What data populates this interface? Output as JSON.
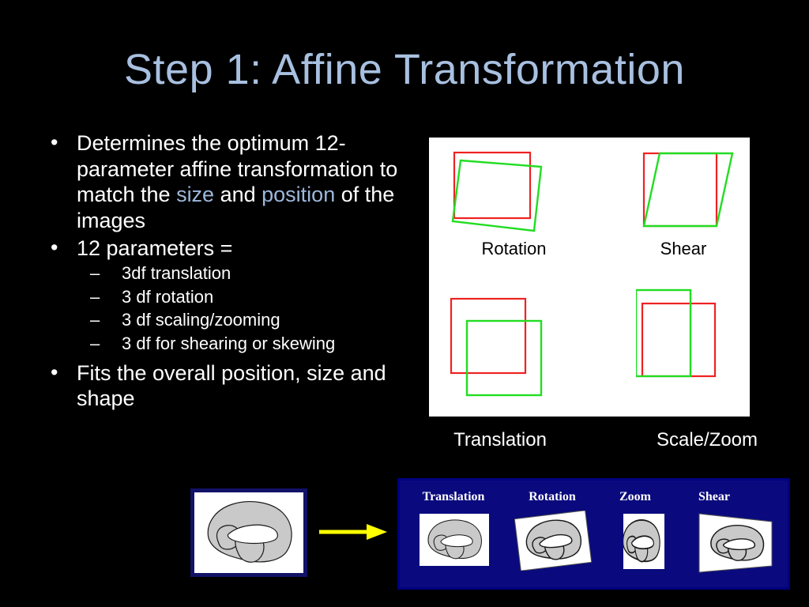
{
  "slide": {
    "title": "Step 1: Affine Transformation",
    "title_color": "#A8C0E0",
    "background_color": "#000000",
    "body_text_color": "#FFFFFF",
    "highlight_color": "#9DB8DC"
  },
  "bullets": {
    "bullet_marker": "•",
    "sub_marker": "–",
    "items": [
      {
        "segments": [
          {
            "text": "Determines the optimum 12-parameter affine transformation to match the ",
            "style": "normal"
          },
          {
            "text": "size",
            "style": "highlight"
          },
          {
            "text": " and ",
            "style": "normal"
          },
          {
            "text": "position",
            "style": "highlight"
          },
          {
            "text": " of the images",
            "style": "normal"
          }
        ]
      },
      {
        "text": "12 parameters =",
        "sub_items": [
          "3df translation",
          "3 df rotation",
          "3 df scaling/zooming",
          "3 df for shearing or skewing"
        ]
      },
      {
        "text": "Fits the overall position, size and  shape"
      }
    ]
  },
  "diagram_panel": {
    "background_color": "#FFFFFF",
    "reference_shape_color": "#ee2222",
    "transformed_shape_color": "#22dd22",
    "inside_captions": [
      {
        "label": "Rotation",
        "color": "#000000"
      },
      {
        "label": "Shear",
        "color": "#000000"
      }
    ],
    "outside_captions": [
      {
        "label": "Translation",
        "color": "#FFFFFF"
      },
      {
        "label": "Scale/Zoom",
        "color": "#FFFFFF"
      }
    ]
  },
  "brain_strip": {
    "background_color": "#0A0A7E",
    "label_color": "#FFFFFF",
    "tiles": [
      {
        "label": "Translation"
      },
      {
        "label": "Rotation"
      },
      {
        "label": "Zoom"
      },
      {
        "label": "Shear"
      }
    ]
  },
  "source_thumbnail": {
    "border_color": "#121268",
    "background_color": "#FFFFFF"
  },
  "arrow": {
    "color": "#FFFF00",
    "direction": "right"
  }
}
